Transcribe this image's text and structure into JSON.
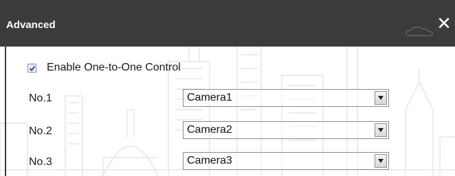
{
  "dialog": {
    "title": "Advanced",
    "close_glyph": "✕"
  },
  "one_to_one": {
    "label": "Enable One-to-One Control",
    "checked": true
  },
  "rows": [
    {
      "label": "No.1",
      "selected": "Camera1"
    },
    {
      "label": "No.2",
      "selected": "Camera2"
    },
    {
      "label": "No.3",
      "selected": "Camera3"
    }
  ],
  "icons": {
    "close": "close-icon",
    "dropdown": "chevron-down-icon",
    "checkbox": "checkmark-icon"
  },
  "colors": {
    "titlebar": "#3b3b3b",
    "title_text": "#ffffff",
    "body_text": "#1a1a1a",
    "background_art": "#e9e9e9"
  }
}
